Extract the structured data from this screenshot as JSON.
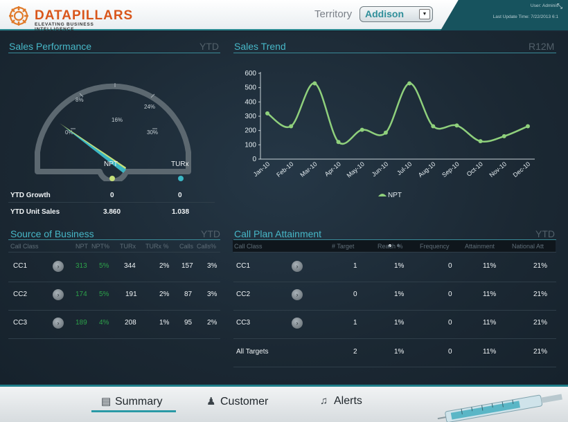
{
  "header": {
    "logo_text": "DATAPILLARS",
    "logo_tagline": "ELEVATING BUSINESS INTELLIGENCE",
    "territory_label": "Territory",
    "territory_value": "Addison",
    "user_text": "User: Adminis",
    "last_update": "Last Update Time: 7/22/2013 6:1",
    "icons": {
      "logo": "datapillars-logo-icon",
      "dropdown": "chevron-down-icon",
      "expand": "expand-icon"
    }
  },
  "sales_performance": {
    "title": "Sales Performance",
    "badge": "YTD",
    "gauge": {
      "ticks": [
        "0%",
        "8%",
        "16%",
        "24%",
        "30%"
      ],
      "needle_values": {
        "NPT": 3,
        "TURx": 2
      }
    },
    "columns": [
      "NPT",
      "TURx"
    ],
    "legend_colors": {
      "NPT": "#c5e07a",
      "TURx": "#3bb6c4"
    },
    "rows": [
      {
        "label": "YTD Growth",
        "npt": "0",
        "turx": "0"
      },
      {
        "label": "YTD Unit Sales",
        "npt": "3.860",
        "turx": "1.038"
      }
    ]
  },
  "sales_trend": {
    "title": "Sales Trend",
    "badge": "R12M",
    "legend_label": "NPT",
    "line_color": "#8fd07c"
  },
  "chart_data": {
    "type": "line",
    "categories": [
      "Jan-10",
      "Feb-10",
      "Mar-10",
      "Apr-10",
      "May-10",
      "Jun-10",
      "Jul-10",
      "Aug-10",
      "Sep-10",
      "Oct-10",
      "Nov-10",
      "Dec-10"
    ],
    "series": [
      {
        "name": "NPT",
        "values": [
          320,
          230,
          530,
          120,
          205,
          185,
          530,
          230,
          235,
          125,
          160,
          230
        ]
      }
    ],
    "ylim": [
      0,
      600
    ],
    "yticks": [
      0,
      100,
      200,
      300,
      400,
      500,
      600
    ],
    "xlabel": "",
    "ylabel": "",
    "title": "",
    "grid": false,
    "legend": "bottom"
  },
  "source_of_business": {
    "title": "Source of Business",
    "badge": "YTD",
    "headers": [
      "Call Class",
      "NPT",
      "NPT%",
      "TURx",
      "TURx %",
      "Calls",
      "Calls%"
    ],
    "rows": [
      {
        "cls": "CC1",
        "npt": "313",
        "npt_pct": "5%",
        "turx": "344",
        "turx_pct": "2%",
        "calls": "157",
        "calls_pct": "3%"
      },
      {
        "cls": "CC2",
        "npt": "174",
        "npt_pct": "5%",
        "turx": "191",
        "turx_pct": "2%",
        "calls": "87",
        "calls_pct": "3%"
      },
      {
        "cls": "CC3",
        "npt": "189",
        "npt_pct": "4%",
        "turx": "208",
        "turx_pct": "1%",
        "calls": "95",
        "calls_pct": "2%"
      }
    ]
  },
  "call_plan": {
    "title": "Call Plan Attainment",
    "badge": "YTD",
    "headers": [
      "Call Class",
      "# Target",
      "Reach %",
      "Frequency",
      "Attainment",
      "National Att"
    ],
    "rows": [
      {
        "cls": "CC1",
        "target": "1",
        "reach": "1%",
        "freq": "0",
        "attain": "11%",
        "national": "21%"
      },
      {
        "cls": "CC2",
        "target": "0",
        "reach": "1%",
        "freq": "0",
        "attain": "11%",
        "national": "21%"
      },
      {
        "cls": "CC3",
        "target": "1",
        "reach": "1%",
        "freq": "0",
        "attain": "11%",
        "national": "21%"
      },
      {
        "cls": "All Targets",
        "target": "2",
        "reach": "1%",
        "freq": "0",
        "attain": "11%",
        "national": "21%"
      }
    ]
  },
  "footer": {
    "tabs": [
      {
        "label": "Summary",
        "icon": "document-icon"
      },
      {
        "label": "Customer",
        "icon": "user-icon"
      },
      {
        "label": "Alerts",
        "icon": "bell-icon"
      }
    ],
    "active_tab": "Summary"
  }
}
